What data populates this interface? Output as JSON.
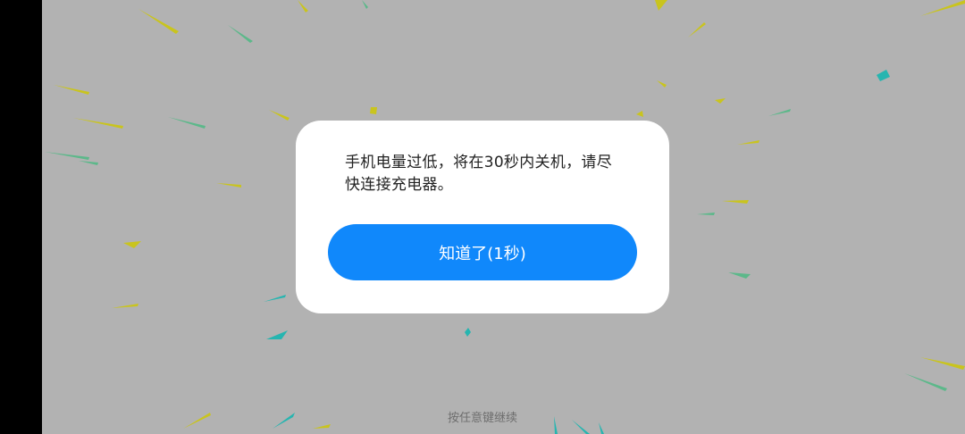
{
  "dialog": {
    "message": "手机电量过低，将在30秒内关机，请尽快连接充电器。",
    "button_label": "知道了(1秒)"
  },
  "footer": {
    "hint": "按任意键继续"
  },
  "colors": {
    "background": "#b2b2b2",
    "button": "#1088fb",
    "dialog": "#ffffff"
  }
}
